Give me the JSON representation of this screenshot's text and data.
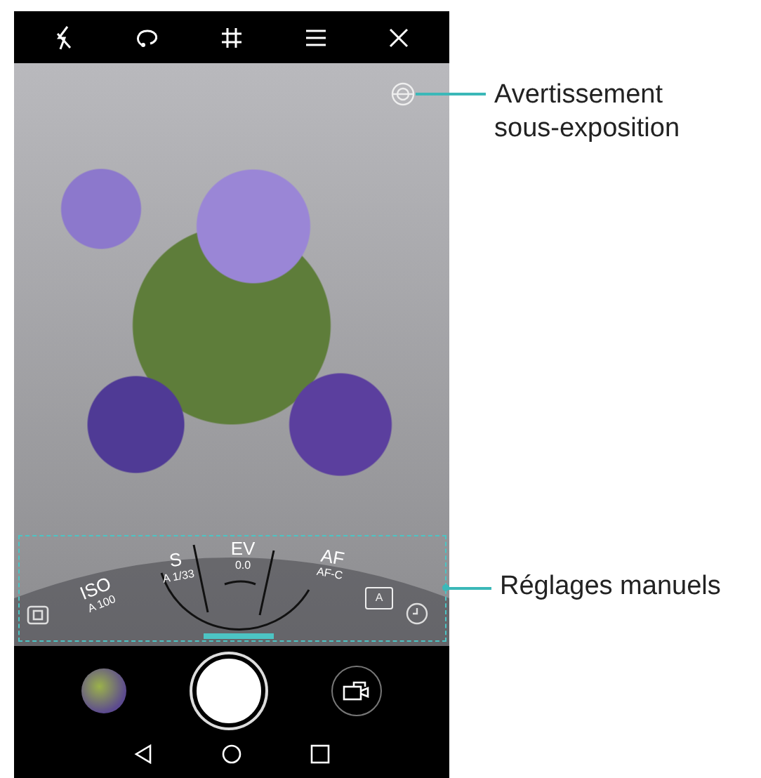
{
  "manual_settings": [
    {
      "name": "ISO",
      "value": "A 100",
      "kind": "setting"
    },
    {
      "name": "S",
      "value": "A 1/33",
      "kind": "setting"
    },
    {
      "name": "EV",
      "value": "0.0",
      "kind": "setting"
    },
    {
      "name": "AF",
      "value": "AF-C",
      "kind": "setting"
    }
  ],
  "white_balance_badge": "A",
  "callouts": [
    {
      "kind": "underexposure",
      "text": "Avertissement sous-exposition"
    },
    {
      "kind": "manual",
      "text": "Réglages manuels"
    }
  ]
}
